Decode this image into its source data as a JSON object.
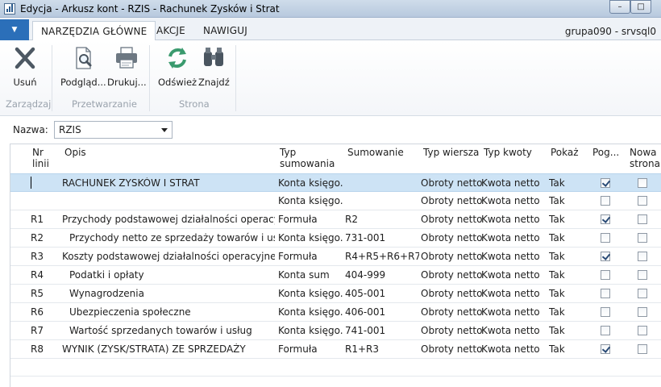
{
  "window": {
    "title": "Edycja - Arkusz kont - RZIS - Rachunek Zysków i Strat",
    "minimize_glyph": "–",
    "maximize_glyph": "□"
  },
  "tabs": {
    "menu_glyph": "▼",
    "items": [
      "NARZĘDZIA GŁÓWNE",
      "AKCJE",
      "NAWIGUJ"
    ],
    "server": "grupa090 - srvsql0"
  },
  "ribbon": {
    "delete_label": "Usuń",
    "preview_label": "Podgląd...",
    "print_label": "Drukuj...",
    "refresh_label": "Odśwież",
    "find_label": "Znajdź",
    "groups": [
      "Zarządzaj",
      "Przetwarzanie",
      "Strona"
    ],
    "icons": [
      "close-icon",
      "preview-icon",
      "printer-icon",
      "refresh-icon",
      "binoculars-icon"
    ],
    "accent": "#2b6fb9"
  },
  "filter": {
    "label": "Nazwa:",
    "value": "RZIS"
  },
  "grid": {
    "headers": {
      "nr": "Nr\nlinii",
      "opis": "Opis",
      "typ": "Typ\nsumowania",
      "sum": "Sumowanie",
      "tw": "Typ wiersza",
      "tk": "Typ kwoty",
      "pok": "Pokaż",
      "pog": "Pog...",
      "now": "Nowa\nstrona"
    },
    "rows": [
      {
        "nr": "",
        "opis": "RACHUNEK ZYSKÓW I STRAT",
        "typ": "Konta księgo...",
        "sum": "",
        "tw": "Obroty netto",
        "tk": "Kwota netto",
        "pok": "Tak",
        "pog": true,
        "now": false
      },
      {
        "nr": "",
        "opis": "",
        "typ": "Konta księgo...",
        "sum": "",
        "tw": "Obroty netto",
        "tk": "Kwota netto",
        "pok": "Tak",
        "pog": false,
        "now": false
      },
      {
        "nr": "R1",
        "opis": "Przychody podstawowej działalności operacyjnej",
        "typ": "Formuła",
        "sum": "R2",
        "tw": "Obroty netto",
        "tk": "Kwota netto",
        "pok": "Tak",
        "pog": true,
        "now": false
      },
      {
        "nr": "R2",
        "opis": "Przychody netto ze sprzedaży towarów i usług",
        "typ": "Konta księgo...",
        "sum": "731-001",
        "tw": "Obroty netto",
        "tk": "Kwota netto",
        "pok": "Tak",
        "pog": false,
        "now": false
      },
      {
        "nr": "R3",
        "opis": "Koszty podstawowej działalności operacyjnej",
        "typ": "Formuła",
        "sum": "R4+R5+R6+R7",
        "tw": "Obroty netto",
        "tk": "Kwota netto",
        "pok": "Tak",
        "pog": true,
        "now": false
      },
      {
        "nr": "R4",
        "opis": "Podatki i opłaty",
        "typ": "Konta sum",
        "sum": "404-999",
        "tw": "Obroty netto",
        "tk": "Kwota netto",
        "pok": "Tak",
        "pog": false,
        "now": false
      },
      {
        "nr": "R5",
        "opis": "Wynagrodzenia",
        "typ": "Konta księgo...",
        "sum": "405-001",
        "tw": "Obroty netto",
        "tk": "Kwota netto",
        "pok": "Tak",
        "pog": false,
        "now": false
      },
      {
        "nr": "R6",
        "opis": "Ubezpieczenia społeczne",
        "typ": "Konta księgo...",
        "sum": "406-001",
        "tw": "Obroty netto",
        "tk": "Kwota netto",
        "pok": "Tak",
        "pog": false,
        "now": false
      },
      {
        "nr": "R7",
        "opis": "Wartość sprzedanych towarów i usług",
        "typ": "Konta księgo...",
        "sum": "741-001",
        "tw": "Obroty netto",
        "tk": "Kwota netto",
        "pok": "Tak",
        "pog": false,
        "now": false
      },
      {
        "nr": "R8",
        "opis": "WYNIK (ZYSK/STRATA) ZE SPRZEDAŻY",
        "typ": "Formuła",
        "sum": "R1+R3",
        "tw": "Obroty netto",
        "tk": "Kwota netto",
        "pok": "Tak",
        "pog": true,
        "now": false
      }
    ]
  }
}
